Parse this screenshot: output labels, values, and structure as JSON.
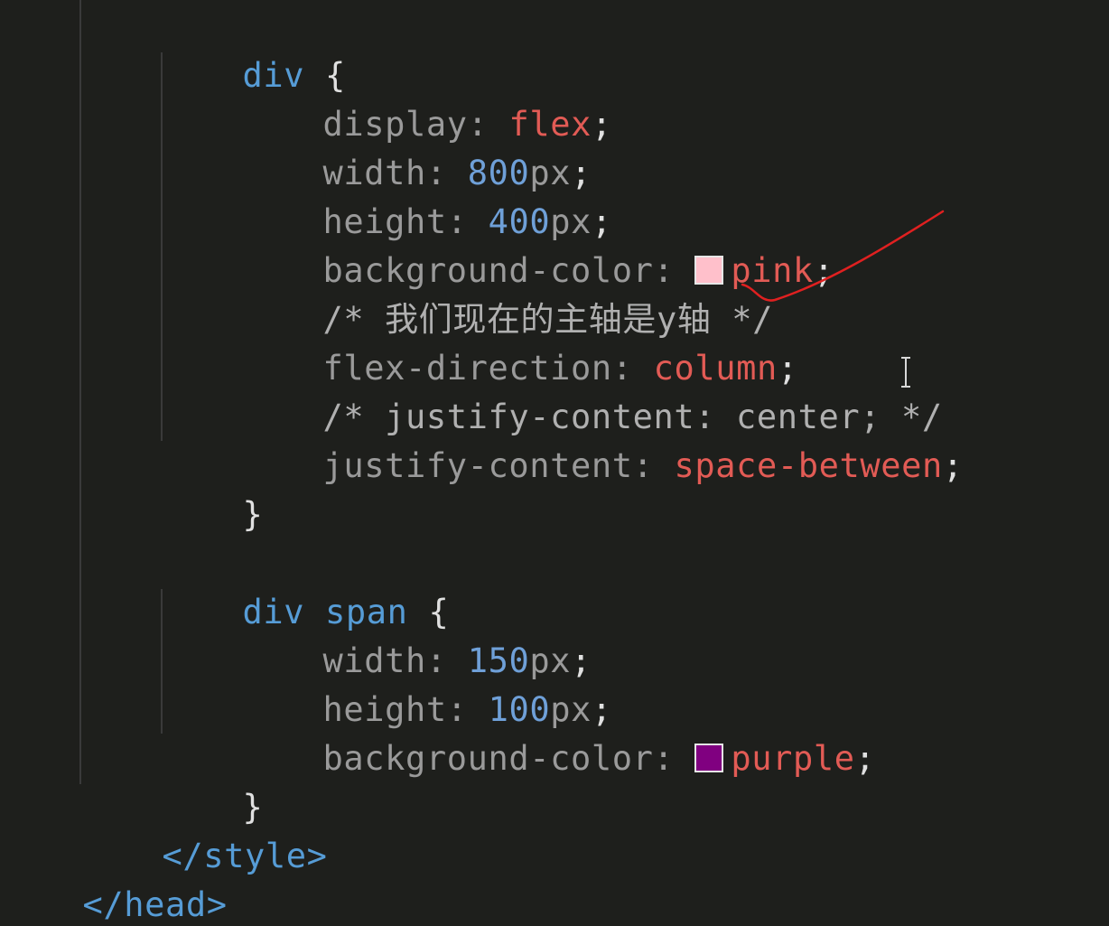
{
  "editor": {
    "language": "css",
    "lines": [
      {
        "selector": "div",
        "open": "{"
      },
      {
        "prop": "display",
        "val": "flex"
      },
      {
        "prop": "width",
        "num": "800",
        "unit": "px"
      },
      {
        "prop": "height",
        "num": "400",
        "unit": "px"
      },
      {
        "prop": "background-color",
        "val": "pink",
        "swatch": "#ffc0cb"
      },
      {
        "comment": "/* 我们现在的主轴是y轴 */"
      },
      {
        "prop": "flex-direction",
        "val": "column"
      },
      {
        "comment": "/* justify-content: center; */"
      },
      {
        "prop": "justify-content",
        "val": "space-between"
      },
      {
        "close": "}"
      },
      {
        "selector": "div",
        "selector2": "span",
        "open": "{"
      },
      {
        "prop": "width",
        "num": "150",
        "unit": "px"
      },
      {
        "prop": "height",
        "num": "100",
        "unit": "px"
      },
      {
        "prop": "background-color",
        "val": "purple",
        "swatch": "#800080"
      },
      {
        "close": "}"
      },
      {
        "tag": "</style>"
      },
      {
        "tag": "</head>"
      }
    ],
    "punct": {
      "colon": ":",
      "semi": ";"
    }
  },
  "colors": {
    "background": "#1e1f1c",
    "tag": "#569cd6",
    "number": "#6fa0d8",
    "value": "#e25b55",
    "property": "#9a9a9a",
    "annotation": "#e02020"
  }
}
